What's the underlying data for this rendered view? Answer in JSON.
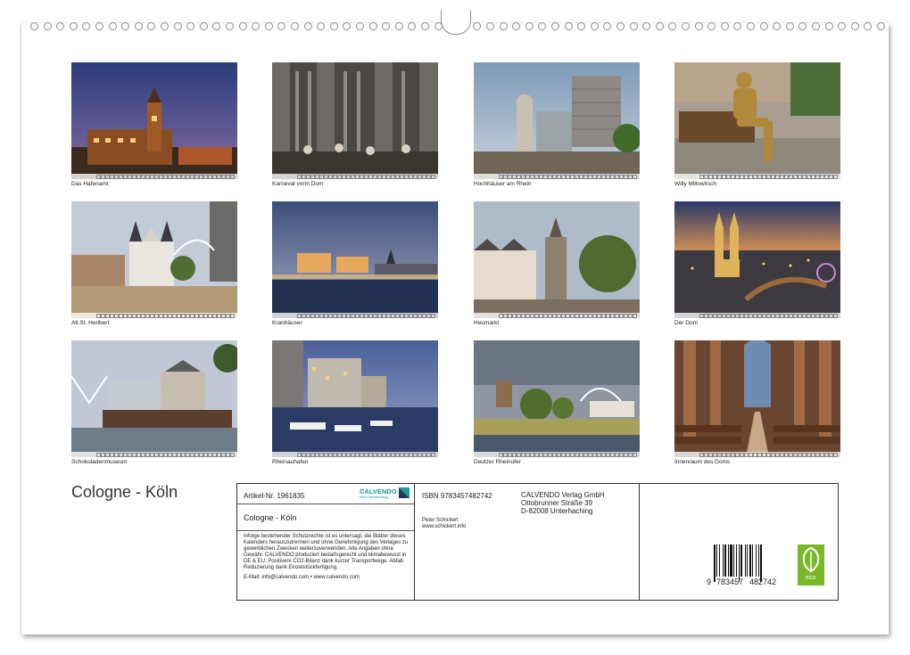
{
  "document": {
    "title": "Cologne - Köln"
  },
  "photos": [
    {
      "caption": "Das Hafenamt",
      "icon": "harbour-office-photo"
    },
    {
      "caption": "Karneval vorm Dom",
      "icon": "carnival-cathedral-photo"
    },
    {
      "caption": "Hochhäuser am Rhein",
      "icon": "highrises-rhine-photo"
    },
    {
      "caption": "Willy Millowitsch",
      "icon": "statue-bench-photo"
    },
    {
      "caption": "Alt.St. Heribert",
      "icon": "church-photo"
    },
    {
      "caption": "Kranhäuser",
      "icon": "crane-houses-photo"
    },
    {
      "caption": "Heumarkt",
      "icon": "heumarkt-photo"
    },
    {
      "caption": "Der Dom",
      "icon": "cathedral-night-photo"
    },
    {
      "caption": "Schokoladenmuseum",
      "icon": "chocolate-museum-photo"
    },
    {
      "caption": "Rheinauhafen",
      "icon": "rheinauhafen-photo"
    },
    {
      "caption": "Deutzer Rheinufer",
      "icon": "deutz-riverbank-photo"
    },
    {
      "caption": "Innenraum des Doms",
      "icon": "cathedral-interior-photo"
    }
  ],
  "info": {
    "article": "Artikel-Nr. 1961835",
    "logo_text": "CALVENDO",
    "logo_sub": "Mein Kalenderverlag",
    "product_title": "Cologne - Köln",
    "legal_text": "Infolge bestehender Schutzrechte ist es untersagt, die Blätter dieses Kalenders herauszutrennen und ohne Genehmigung des Verlages zu gewerblichen Zwecken weiterzuverwenden. Alle Angaben ohne Gewähr. CALVENDO produziert bedarfsgerecht und klimabewusst in DE & EU. Positivere CO2-Bilanz dank kurzer Transportwege. Abfall-Reduzierung dank Einzelstückfertigung.",
    "contact": "E-Mail: info@calvendo.com • www.calvendo.com",
    "isbn": "ISBN 9783457482742",
    "author": "Peter Schickert",
    "author_site": "www.schickert.info",
    "publisher": [
      "CALVENDO Verlag GmbH",
      "Ottobrunner Straße 39",
      "D-82008 Unterhaching"
    ],
    "barcode_first": "9",
    "barcode_left": "783457",
    "barcode_right": "482742",
    "eco_label": "eco"
  },
  "colors": {
    "eco_green": "#7ab829",
    "logo_teal": "#1d9a9a"
  }
}
